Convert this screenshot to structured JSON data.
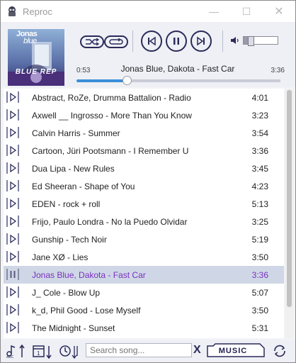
{
  "window": {
    "title": "Reproc",
    "minimize_glyph": "—",
    "maximize_glyph": "☐",
    "close_glyph": "✕"
  },
  "album_art": {
    "line1": "Jonas",
    "line2": "blue",
    "subtitle": "BLUE REP"
  },
  "player": {
    "now_playing": "Jonas Blue, Dakota - Fast Car",
    "elapsed": "0:53",
    "total": "3:36",
    "progress": 0.245,
    "volume": 0.2,
    "icons": [
      "shuffle-icon",
      "repeat-icon",
      "previous-icon",
      "pause-icon",
      "next-icon",
      "volume-icon"
    ]
  },
  "playlist": [
    {
      "title": "Abstract, RoZe, Drumma Battalion - Radio",
      "duration": "4:01"
    },
    {
      "title": "Axwell __ Ingrosso - More Than You Know",
      "duration": "3:23"
    },
    {
      "title": "Calvin Harris - Summer",
      "duration": "3:54"
    },
    {
      "title": "Cartoon, Jüri Pootsmann - I Remember U",
      "duration": "3:36"
    },
    {
      "title": "Dua Lipa - New Rules",
      "duration": "3:45"
    },
    {
      "title": "Ed Sheeran - Shape of You",
      "duration": "4:23"
    },
    {
      "title": "EDEN - rock + roll",
      "duration": "5:13"
    },
    {
      "title": "Frijo, Paulo Londra - No la Puedo Olvidar",
      "duration": "3:25"
    },
    {
      "title": "Gunship - Tech Noir",
      "duration": "5:19"
    },
    {
      "title": "Jane XØ - Lies",
      "duration": "3:50"
    },
    {
      "title": "Jonas Blue, Dakota - Fast Car",
      "duration": "3:36",
      "playing": true
    },
    {
      "title": "J_ Cole - Blow Up",
      "duration": "5:07"
    },
    {
      "title": "k_d, Phil Good - Lose Myself",
      "duration": "3:50"
    },
    {
      "title": "The Midnight - Sunset",
      "duration": "5:31"
    }
  ],
  "footer": {
    "search_placeholder": "Search song...",
    "clear_glyph": "X",
    "library_label": "MUSIC",
    "icons": [
      "sort-alpha-icon",
      "sort-date-icon",
      "sort-duration-icon",
      "refresh-icon"
    ]
  },
  "colors": {
    "accent": "#3b8fd8",
    "playing_text": "#7a2fbf",
    "playing_bg": "#cfd7e6",
    "icon_stroke": "#2a2a5a"
  }
}
